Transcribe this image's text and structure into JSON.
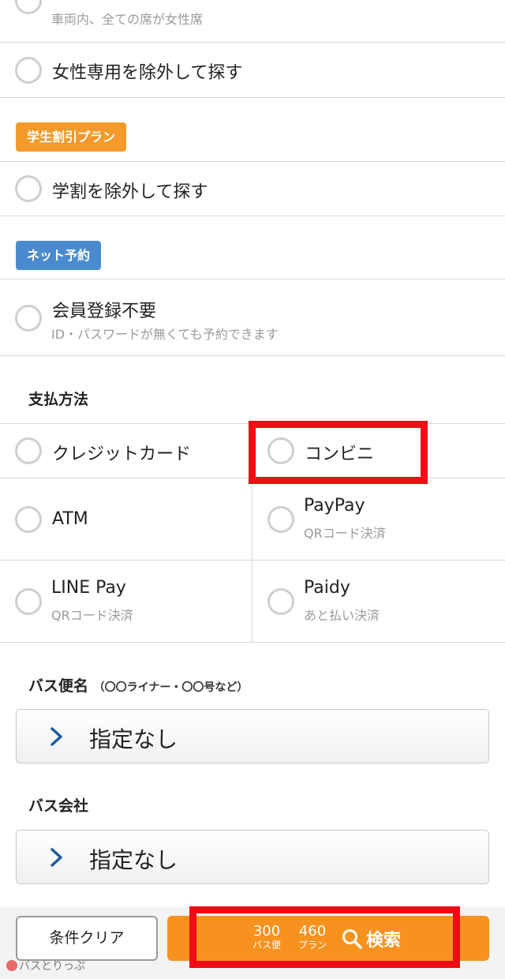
{
  "women_section": {
    "top_cut_sub": "車両内、全ての席が女性席",
    "exclude_label": "女性専用を除外して探す"
  },
  "student_section": {
    "tag": "学生割引プラン",
    "exclude_label": "学割を除外して探す"
  },
  "net_section": {
    "tag": "ネット予約",
    "option_label": "会員登録不要",
    "option_sub": "ID・パスワードが無くても予約できます"
  },
  "payment": {
    "title": "支払方法",
    "options": [
      {
        "label": "クレジットカード",
        "sub": ""
      },
      {
        "label": "コンビニ",
        "sub": ""
      },
      {
        "label": "ATM",
        "sub": ""
      },
      {
        "label": "PayPay",
        "sub": "QRコード決済"
      },
      {
        "label": "LINE Pay",
        "sub": "QRコード決済"
      },
      {
        "label": "Paidy",
        "sub": "あと払い決済"
      }
    ]
  },
  "bus_name": {
    "title": "バス便名",
    "note": "（〇〇ライナー・〇〇号など）",
    "value": "指定なし"
  },
  "bus_company": {
    "title": "バス会社",
    "value": "指定なし"
  },
  "footer": {
    "clear_label": "条件クリア",
    "bus_count": "300",
    "bus_unit": "バス便",
    "plan_count": "460",
    "plan_unit": "プラン",
    "search_label": "検索"
  },
  "watermark": "バスとりっぷ",
  "colors": {
    "orange_tag": "#f39a2b",
    "blue_tag": "#4a8bd0",
    "search_button": "#f7921e",
    "highlight": "#ee0d14"
  }
}
